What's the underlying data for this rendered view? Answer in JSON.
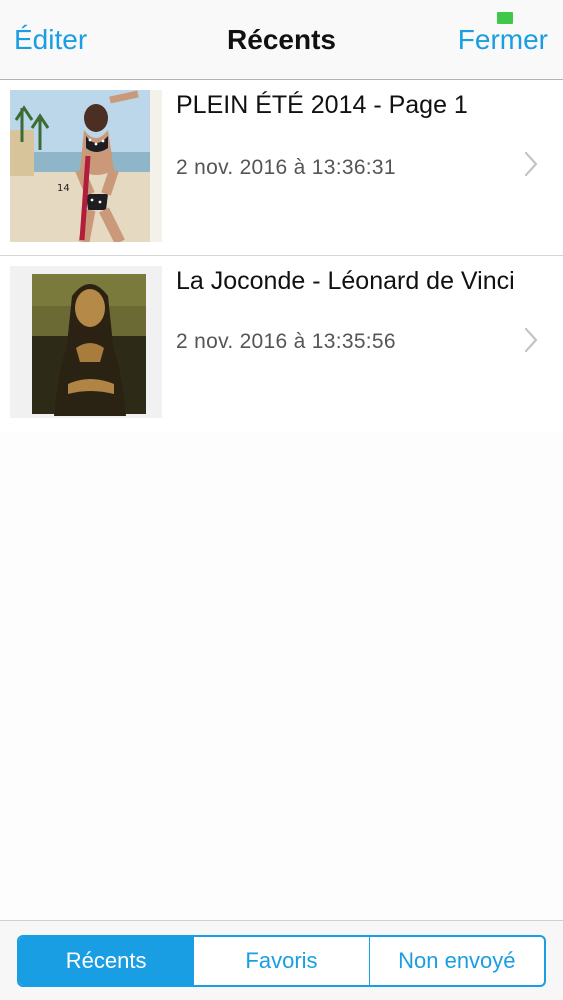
{
  "navbar": {
    "left_label": "Éditer",
    "title": "Récents",
    "right_label": "Fermer"
  },
  "documents": [
    {
      "title": "PLEIN ÉTÉ 2014 - Page 1",
      "date": "2 nov. 2016 à 13:36:31",
      "thumbnail_text": "14"
    },
    {
      "title": "La Joconde - Léonard de Vinci",
      "date": "2 nov. 2016 à 13:35:56"
    }
  ],
  "tabs": [
    {
      "label": "Récents",
      "active": true
    },
    {
      "label": "Favoris",
      "active": false
    },
    {
      "label": "Non envoyé",
      "active": false
    }
  ],
  "colors": {
    "accent": "#1a9ee3",
    "status_indicator": "#3fc74a"
  }
}
